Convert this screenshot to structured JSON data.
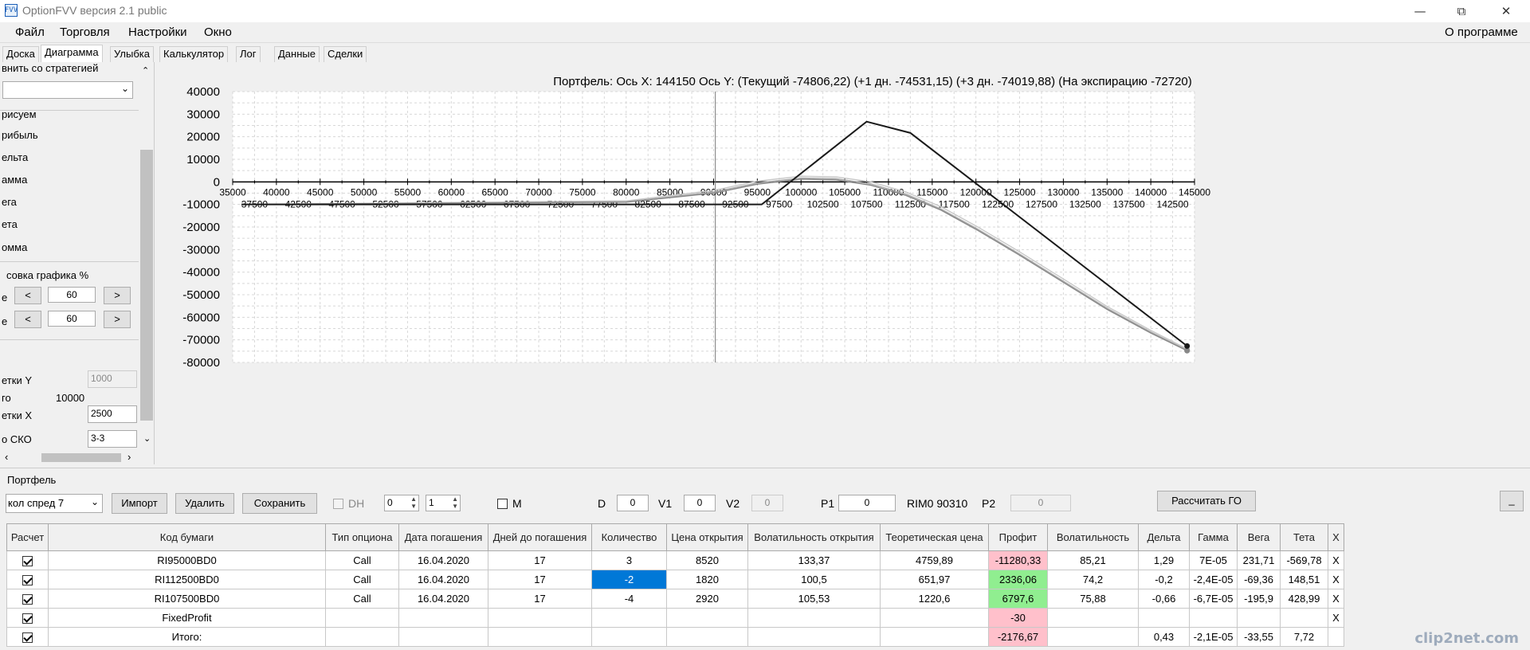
{
  "window": {
    "title": "OptionFVV версия 2.1 public",
    "icon_text": "FVV"
  },
  "menu": {
    "items": [
      "Файл",
      "Торговля",
      "Настройки",
      "Окно"
    ],
    "about": "О программе"
  },
  "tabs": [
    "Доска",
    "Диаграмма",
    "Улыбка",
    "Калькулятор",
    "Лог",
    "Данные",
    "Сделки"
  ],
  "active_tab": "Диаграмма",
  "left": {
    "compare_label": "внить со стратегией",
    "draw_label": "рисуем",
    "options": [
      "рибыль",
      "ельта",
      "амма",
      "ега",
      "ета",
      "омма"
    ],
    "scale_label": "совка графика %",
    "scale1": {
      "prefix": "е",
      "prev": "<",
      "value": "60",
      "next": ">"
    },
    "scale2": {
      "prefix": "е",
      "prev": "<",
      "value": "60",
      "next": ">"
    },
    "grid_y_label": "етки Y",
    "grid_y_value": "1000",
    "step_label": "го",
    "step_value": "10000",
    "grid_x_label": "етки X",
    "grid_x_value": "2500",
    "sko_label": "о СКО",
    "sko_value": "3-3"
  },
  "chart_title": "Портфель: Ось X: 144150 Ось Y:  (Текущий -74806,22)  (+1 дн. -74531,15)  (+3 дн. -74019,88)  (На экспирацию -72720)",
  "chart_data": {
    "type": "line",
    "xlim": [
      35000,
      145000
    ],
    "ylim": [
      -80000,
      40000
    ],
    "y_ticks": [
      40000,
      30000,
      20000,
      10000,
      0,
      -10000,
      -20000,
      -30000,
      -40000,
      -50000,
      -60000,
      -70000,
      -80000
    ],
    "x_ticks_major": [
      35000,
      40000,
      45000,
      50000,
      55000,
      60000,
      65000,
      70000,
      75000,
      80000,
      85000,
      90000,
      95000,
      100000,
      105000,
      110000,
      115000,
      120000,
      125000,
      130000,
      135000,
      140000,
      145000
    ],
    "x_ticks_minor": [
      37500,
      42500,
      47500,
      52500,
      57500,
      62500,
      67500,
      72500,
      77500,
      82500,
      87500,
      92500,
      97500,
      102500,
      107500,
      112500,
      117500,
      122500,
      127500,
      132500,
      137500,
      142500
    ],
    "cursor_x": 90200,
    "series": [
      {
        "color": "#1a1a1a",
        "x": [
          36000,
          95500,
          107500,
          112500,
          144150
        ],
        "y": [
          -10000,
          -10000,
          26700,
          21700,
          -72720
        ]
      },
      {
        "color": "#888888",
        "x": [
          36000,
          80000,
          90000,
          95000,
          100000,
          104000,
          108000,
          112000,
          116000,
          120000,
          125000,
          130000,
          135000,
          140000,
          144150
        ],
        "y": [
          -10000,
          -9000,
          -5000,
          -1000,
          1200,
          900,
          -1500,
          -6000,
          -12500,
          -21000,
          -32500,
          -44500,
          -56500,
          -67000,
          -74806.22
        ]
      },
      {
        "color": "#aaaaaa",
        "x": [
          36000,
          80000,
          90000,
          95000,
          100000,
          104000,
          108000,
          112000,
          116000,
          120000,
          125000,
          130000,
          135000,
          140000,
          144150
        ],
        "y": [
          -10000,
          -8800,
          -4500,
          -500,
          1700,
          1400,
          -900,
          -5400,
          -12000,
          -20500,
          -32000,
          -44000,
          -56000,
          -66500,
          -74531.15
        ]
      },
      {
        "color": "#c8c8c8",
        "x": [
          36000,
          80000,
          90000,
          95000,
          100000,
          104000,
          108000,
          112000,
          116000,
          120000,
          125000,
          130000,
          135000,
          140000,
          144150
        ],
        "y": [
          -10000,
          -8400,
          -3800,
          300,
          2500,
          2200,
          0,
          -4500,
          -11000,
          -19500,
          -31000,
          -43000,
          -55200,
          -65800,
          -74019.88
        ]
      }
    ]
  },
  "portfolio": {
    "section_label": "Портфель",
    "strategy": "кол спред 7",
    "import": "Импорт",
    "delete": "Удалить",
    "save": "Сохранить",
    "dh": "DH",
    "spin1": "0",
    "spin2": "1",
    "m": "M",
    "d_label": "D",
    "d_value": "0",
    "v1_label": "V1",
    "v1_value": "0",
    "v2_label": "V2",
    "v2_value": "0",
    "p1_label": "P1",
    "p1_value": "0",
    "rim": "RIM0 90310",
    "p2_label": "P2",
    "p2_value": "0",
    "calc_go": "Рассчитать ГО",
    "minimize": "_"
  },
  "table": {
    "headers": [
      "Расчет",
      "Код бумаги",
      "Тип опциона",
      "Дата погашения",
      "Дней до погашения",
      "Количество",
      "Цена открытия",
      "Волатильность открытия",
      "Теоретическая цена",
      "Профит",
      "Волатильность",
      "Дельта",
      "Гамма",
      "Вега",
      "Тета",
      "X"
    ],
    "rows": [
      [
        "",
        "RI95000BD0",
        "Call",
        "16.04.2020",
        "17",
        "3",
        "8520",
        "133,37",
        "4759,89",
        "-11280,33",
        "85,21",
        "1,29",
        "7E-05",
        "231,71",
        "-569,78",
        "X"
      ],
      [
        "",
        "RI112500BD0",
        "Call",
        "16.04.2020",
        "17",
        "-2",
        "1820",
        "100,5",
        "651,97",
        "2336,06",
        "74,2",
        "-0,2",
        "-2,4E-05",
        "-69,36",
        "148,51",
        "X"
      ],
      [
        "",
        "RI107500BD0",
        "Call",
        "16.04.2020",
        "17",
        "-4",
        "2920",
        "105,53",
        "1220,6",
        "6797,6",
        "75,88",
        "-0,66",
        "-6,7E-05",
        "-195,9",
        "428,99",
        "X"
      ],
      [
        "",
        "FixedProfit",
        "",
        "",
        "",
        "",
        "",
        "",
        "",
        "-30",
        "",
        "",
        "",
        "",
        "",
        "X"
      ],
      [
        "",
        "Итого:",
        "",
        "",
        "",
        "",
        "",
        "",
        "",
        "-2176,67",
        "",
        "0,43",
        "-2,1E-05",
        "-33,55",
        "7,72",
        ""
      ]
    ],
    "profit_colors": [
      "red",
      "green",
      "green",
      "red",
      "red"
    ]
  },
  "watermark": "clip2net.com"
}
